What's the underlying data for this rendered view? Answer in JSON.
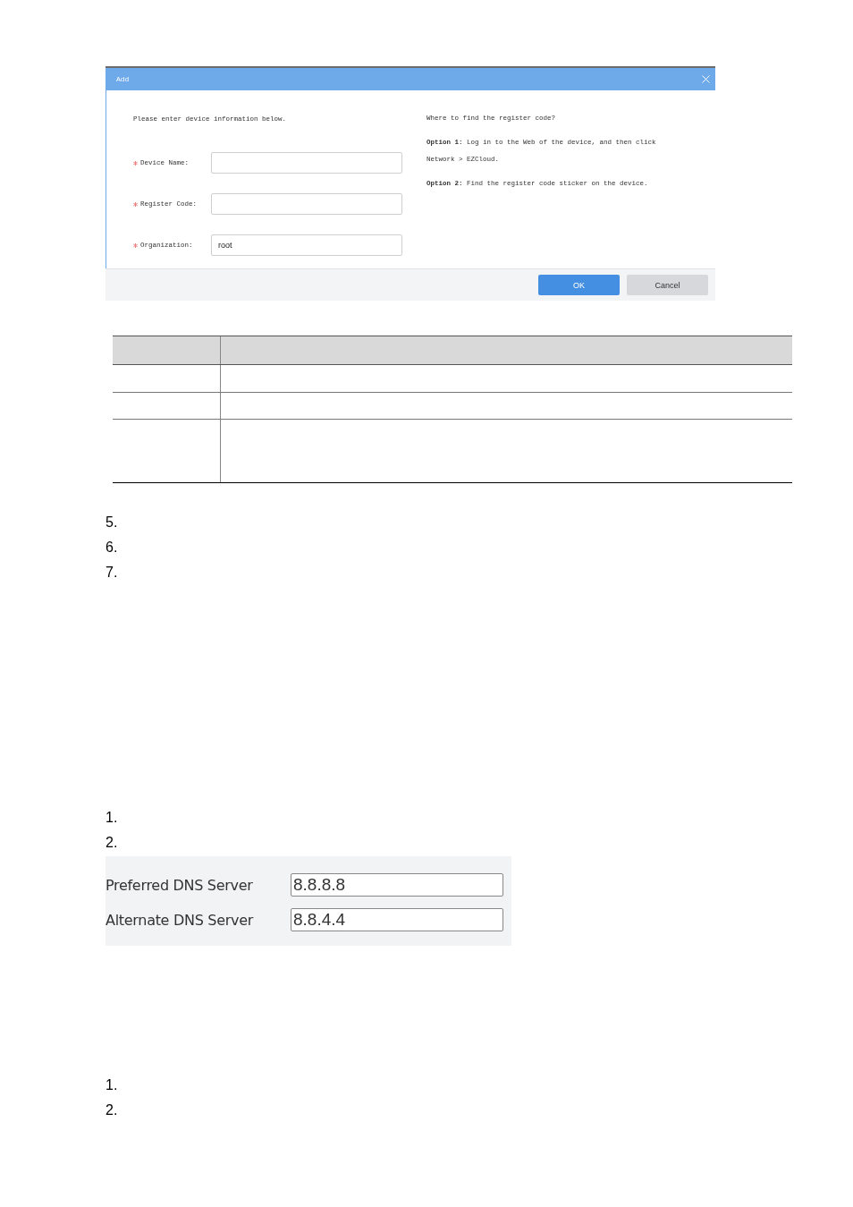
{
  "dialog": {
    "title": "Add",
    "intro": "Please enter device information below.",
    "fields": [
      {
        "label": "Device Name:",
        "required": true
      },
      {
        "label": "Register Code:",
        "required": true
      },
      {
        "label": "Organization:",
        "required": true,
        "value": "root"
      }
    ],
    "help": {
      "title": "Where to find the register code?",
      "options": [
        "**Option 1:** Log in to the Web of the device, and then click Network > EZCloud.",
        "**Option 2:** Find the register code sticker on the device."
      ]
    },
    "buttons": [
      {
        "label": "OK",
        "kind": "primary"
      },
      {
        "label": "Cancel",
        "kind": "secondary"
      }
    ]
  },
  "steps_a": [
    "5.",
    "6.",
    "7."
  ],
  "steps_b": [
    "1.",
    "2."
  ],
  "dns": [
    {
      "label": "Preferred DNS Server",
      "value": "8.8.8.8"
    },
    {
      "label": "Alternate DNS Server",
      "value": "8.8.4.4"
    }
  ],
  "steps_c": [
    "1.",
    "2."
  ]
}
